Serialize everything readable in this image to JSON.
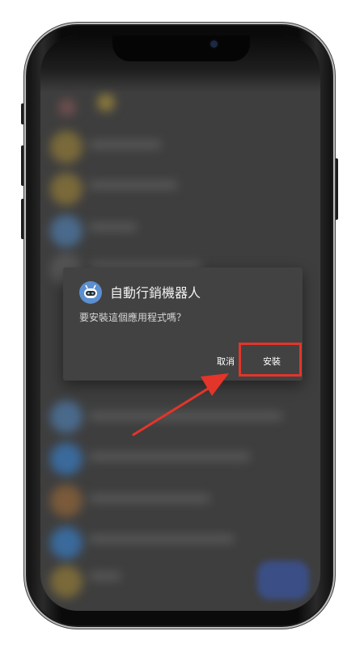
{
  "dialog": {
    "app_name": "自動行銷機器人",
    "message": "要安裝這個應用程式嗎？",
    "cancel_label": "取消",
    "install_label": "安裝"
  },
  "colors": {
    "highlight": "#e3352a",
    "dialog_bg": "#424242",
    "app_icon": "#5b8fd0"
  },
  "icons": {
    "app": "robot-icon",
    "pointer": "arrow-icon"
  }
}
